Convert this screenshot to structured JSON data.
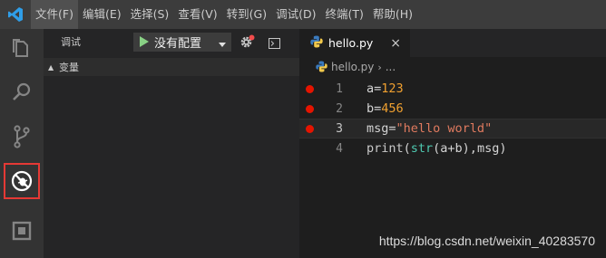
{
  "menubar": {
    "items": [
      "文件(F)",
      "编辑(E)",
      "选择(S)",
      "查看(V)",
      "转到(G)",
      "调试(D)",
      "终端(T)",
      "帮助(H)"
    ]
  },
  "activitybar": {
    "icons": [
      "files-icon",
      "search-icon",
      "source-control-icon",
      "debug-icon",
      "extensions-icon"
    ],
    "highlight_color": "#e53935"
  },
  "debug": {
    "title": "调试",
    "config": "没有配置",
    "variables_section": "变量"
  },
  "editor": {
    "tab_label": "hello.py",
    "tab_close": "×",
    "breadcrumb_file": "hello.py",
    "breadcrumb_sep": "›",
    "breadcrumb_more": "...",
    "current_line": 3,
    "lines": [
      {
        "num": "1",
        "breakpoint": true
      },
      {
        "num": "2",
        "breakpoint": true
      },
      {
        "num": "3",
        "breakpoint": true
      },
      {
        "num": "4",
        "breakpoint": false
      }
    ],
    "code": {
      "l1_a": "a",
      "l1_eq": "=",
      "l1_val": "123",
      "l2_b": "b",
      "l2_eq": "=",
      "l2_val": "456",
      "l3_msg": "msg",
      "l3_eq": "=",
      "l3_val": "\"hello world\"",
      "l4_print": "print",
      "l4_open": "(",
      "l4_str": "str",
      "l4_args": "(a+b),msg)"
    }
  },
  "colors": {
    "breakpoint": "#e51400",
    "number": "#f0a030",
    "string": "#e07a5f",
    "builtin": "#4ec9b0"
  },
  "watermark": "https://blog.csdn.net/weixin_40283570"
}
